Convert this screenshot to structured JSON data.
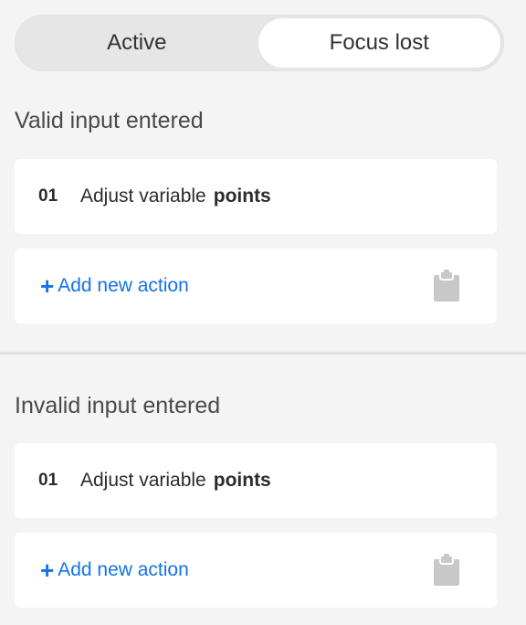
{
  "toggle": {
    "options": [
      "Active",
      "Focus lost"
    ],
    "selected": "Focus lost"
  },
  "sections": [
    {
      "title": "Valid input entered",
      "step": {
        "number": "01",
        "text": "Adjust variable",
        "bold": "points"
      },
      "add_action": {
        "plus": "+",
        "label": "Add new action"
      },
      "icon": "clipboard-icon"
    },
    {
      "title": "Invalid input entered",
      "step": {
        "number": "01",
        "text": "Adjust variable",
        "bold": "points"
      },
      "add_action": {
        "plus": "+",
        "label": "Add new action"
      },
      "icon": "clipboard-icon"
    }
  ],
  "colors": {
    "accent": "#1473e6",
    "background": "#f4f4f4",
    "card": "#ffffff",
    "icon": "#c8c8c8"
  }
}
